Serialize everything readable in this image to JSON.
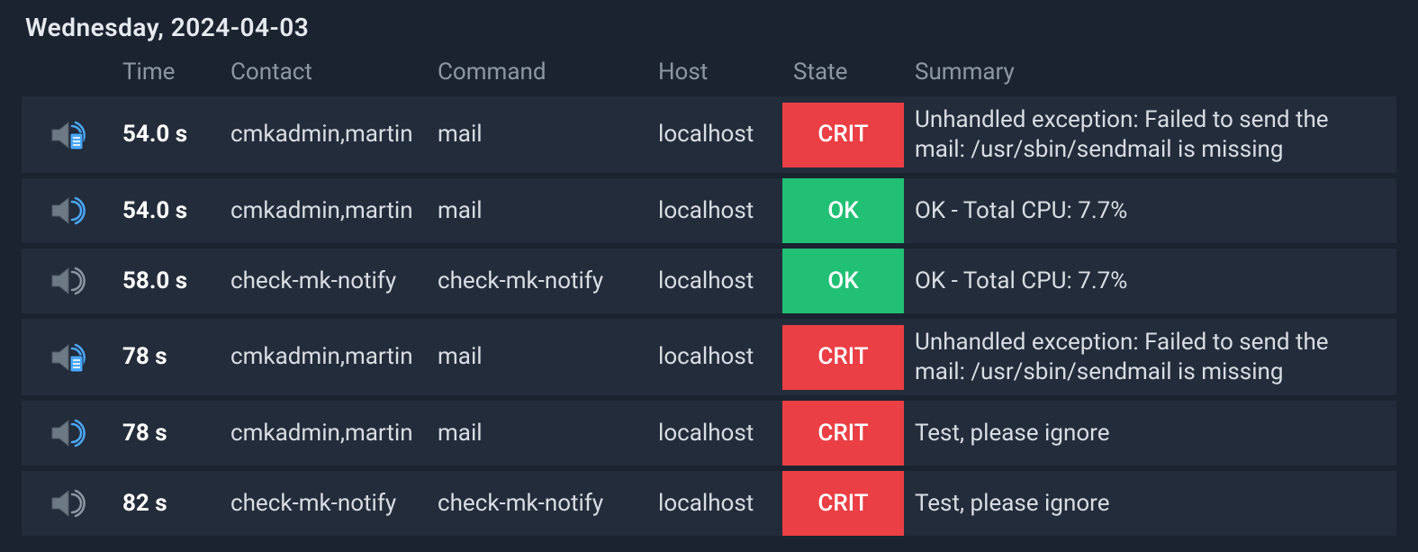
{
  "date_header": "Wednesday, 2024-04-03",
  "columns": {
    "time": "Time",
    "contact": "Contact",
    "command": "Command",
    "host": "Host",
    "state": "State",
    "summary": "Summary"
  },
  "rows": [
    {
      "icon": "speaker-doc",
      "time": "54.0 s",
      "contact": "cmkadmin,martin",
      "command": "mail",
      "host": "localhost",
      "state": "CRIT",
      "summary": "Unhandled exception: Failed to send the mail: /usr/sbin/sendmail is missing"
    },
    {
      "icon": "speaker-blue",
      "time": "54.0 s",
      "contact": "cmkadmin,martin",
      "command": "mail",
      "host": "localhost",
      "state": "OK",
      "summary": "OK - Total CPU: 7.7%"
    },
    {
      "icon": "speaker-grey",
      "time": "58.0 s",
      "contact": "check-mk-notify",
      "command": "check-mk-notify",
      "host": "localhost",
      "state": "OK",
      "summary": "OK - Total CPU: 7.7%"
    },
    {
      "icon": "speaker-doc",
      "time": "78 s",
      "contact": "cmkadmin,martin",
      "command": "mail",
      "host": "localhost",
      "state": "CRIT",
      "summary": "Unhandled exception: Failed to send the mail: /usr/sbin/sendmail is missing"
    },
    {
      "icon": "speaker-blue",
      "time": "78 s",
      "contact": "cmkadmin,martin",
      "command": "mail",
      "host": "localhost",
      "state": "CRIT",
      "summary": "Test, please ignore"
    },
    {
      "icon": "speaker-grey",
      "time": "82 s",
      "contact": "check-mk-notify",
      "command": "check-mk-notify",
      "host": "localhost",
      "state": "CRIT",
      "summary": "Test, please ignore"
    }
  ]
}
